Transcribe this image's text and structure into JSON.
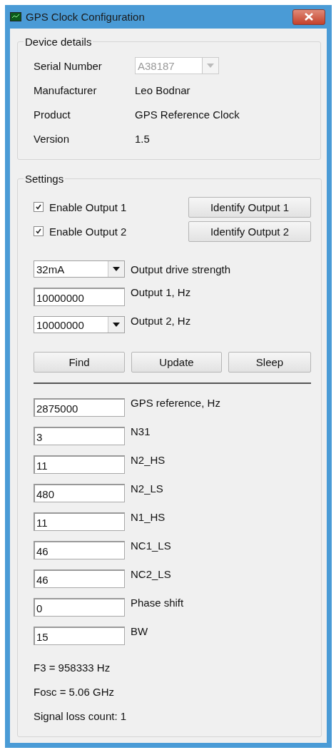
{
  "window": {
    "title": "GPS Clock Configuration"
  },
  "device_details": {
    "title": "Device details",
    "rows": [
      {
        "label": "Serial Number",
        "kind": "combo",
        "value": "A38187",
        "disabled": true
      },
      {
        "label": "Manufacturer",
        "kind": "text",
        "value": "Leo Bodnar"
      },
      {
        "label": "Product",
        "kind": "text",
        "value": "GPS Reference Clock"
      },
      {
        "label": "Version",
        "kind": "text",
        "value": "1.5"
      }
    ]
  },
  "settings": {
    "title": "Settings",
    "outputs": [
      {
        "label": "Enable Output 1",
        "checked": true,
        "button": "Identify Output 1"
      },
      {
        "label": "Enable Output 2",
        "checked": true,
        "button": "Identify Output 2"
      }
    ],
    "config_fields": [
      {
        "kind": "combo",
        "value": "32mA",
        "label": "Output drive strength"
      },
      {
        "kind": "text",
        "value": "10000000",
        "label": "Output 1, Hz"
      },
      {
        "kind": "combo",
        "value": "10000000",
        "label": "Output 2, Hz"
      }
    ],
    "actions": [
      "Find",
      "Update",
      "Sleep"
    ],
    "params": [
      {
        "value": "2875000",
        "label": "GPS reference, Hz"
      },
      {
        "value": "3",
        "label": "N31"
      },
      {
        "value": "11",
        "label": "N2_HS"
      },
      {
        "value": "480",
        "label": "N2_LS"
      },
      {
        "value": "11",
        "label": "N1_HS"
      },
      {
        "value": "46",
        "label": "NC1_LS"
      },
      {
        "value": "46",
        "label": "NC2_LS"
      },
      {
        "value": "0",
        "label": "Phase shift"
      },
      {
        "value": "15",
        "label": "BW"
      }
    ],
    "status": [
      "F3 = 958333 Hz",
      "Fosc = 5.06 GHz",
      "Signal loss count: 1"
    ]
  }
}
